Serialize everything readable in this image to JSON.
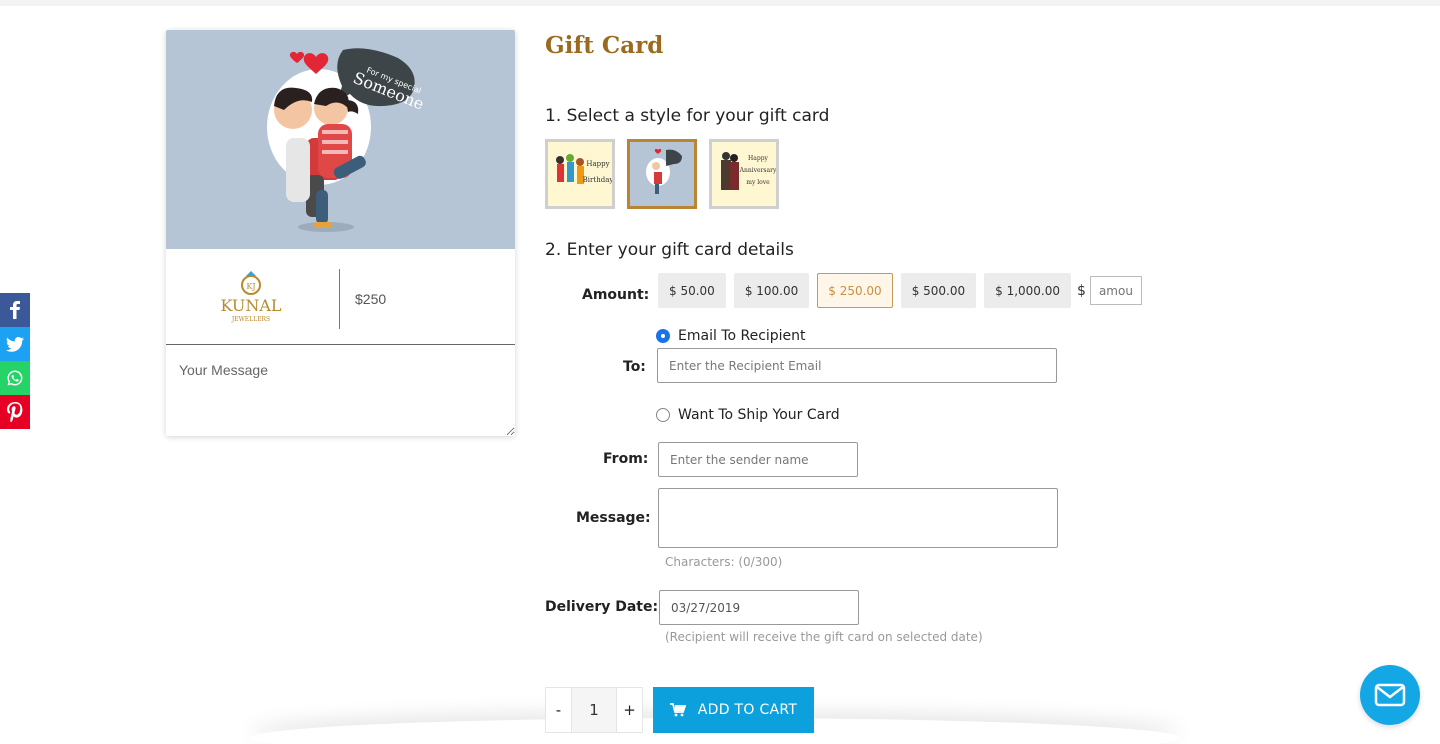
{
  "social": {
    "icons": [
      "facebook-icon",
      "twitter-icon",
      "whatsapp-icon",
      "pinterest-icon"
    ],
    "colors": {
      "facebook": "#3b5998",
      "twitter": "#1da1f2",
      "whatsapp": "#25d366",
      "pinterest": "#e60023"
    }
  },
  "preview": {
    "bubble_line1": "For my special",
    "bubble_line2": "Someone",
    "logo_name": "KUNAL",
    "logo_sub": "JEWELLERS",
    "amount": "$250",
    "message_placeholder": "Your Message"
  },
  "page": {
    "title": "Gift Card",
    "step1": "1. Select a style for your gift card",
    "step2": "2. Enter your gift card details"
  },
  "styles": [
    {
      "name": "Happy Birthday",
      "selected": false
    },
    {
      "name": "For my special Someone",
      "selected": true
    },
    {
      "name": "Happy Anniversary my love",
      "selected": false
    }
  ],
  "form": {
    "amount_label": "Amount:",
    "amounts": [
      "$ 50.00",
      "$ 100.00",
      "$ 250.00",
      "$ 500.00",
      "$ 1,000.00"
    ],
    "selected_amount": "$ 250.00",
    "currency": "$",
    "custom_amount_placeholder": "amou",
    "email_option": "Email To Recipient",
    "to_label": "To:",
    "to_placeholder": "Enter the Recipient Email",
    "ship_option": "Want To Ship Your Card",
    "from_label": "From:",
    "from_placeholder": "Enter the sender name",
    "message_label": "Message:",
    "char_count": "Characters: (0/300)",
    "date_label": "Delivery Date:",
    "date_value": "03/27/2019",
    "date_hint": "(Recipient will receive the gift card on selected date)"
  },
  "cart": {
    "minus": "-",
    "quantity": "1",
    "plus": "+",
    "button_label": "ADD TO CART",
    "button_color": "#0ca0dc"
  },
  "accent": "#9b6a1f"
}
